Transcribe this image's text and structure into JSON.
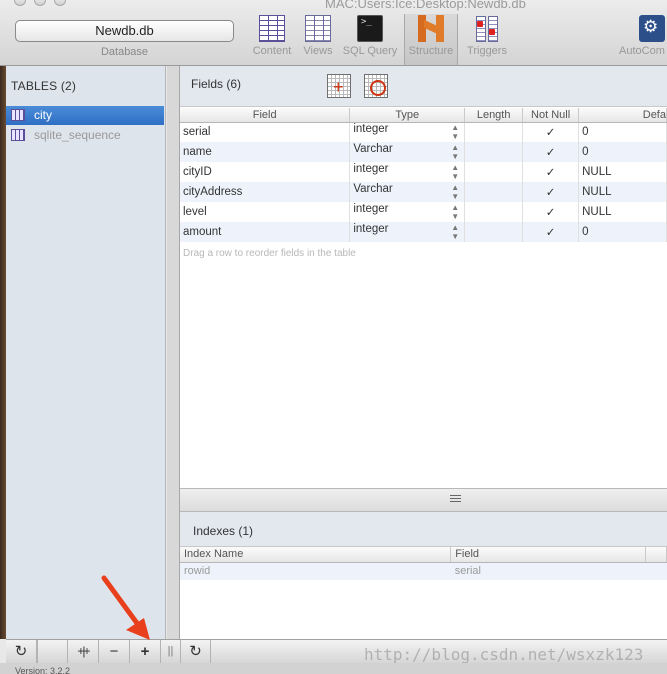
{
  "window": {
    "title": "MAC:Users:Ice:Desktop:Newdb.db"
  },
  "toolbar": {
    "database_value": "Newdb.db",
    "database_label": "Database",
    "items": [
      {
        "label": "Content",
        "icon": "table-icon"
      },
      {
        "label": "Views",
        "icon": "views-icon"
      },
      {
        "label": "SQL Query",
        "icon": "terminal-icon"
      },
      {
        "label": "Structure",
        "icon": "structure-icon"
      },
      {
        "label": "Triggers",
        "icon": "triggers-icon"
      },
      {
        "label": "AutoCom",
        "icon": "gear-icon"
      }
    ]
  },
  "sidebar": {
    "header": "TABLES (2)",
    "tables": [
      "city",
      "sqlite_sequence"
    ]
  },
  "fields": {
    "title": "Fields (6)",
    "columns": [
      "Field",
      "Type",
      "Length",
      "Not Null",
      "Defa"
    ],
    "rows": [
      {
        "field": "serial",
        "type": "integer",
        "length": "",
        "not_null": "✓",
        "default": "0"
      },
      {
        "field": "name",
        "type": "Varchar",
        "length": "",
        "not_null": "✓",
        "default": "0"
      },
      {
        "field": "cityID",
        "type": "integer",
        "length": "",
        "not_null": "✓",
        "default": "NULL"
      },
      {
        "field": "cityAddress",
        "type": "Varchar",
        "length": "",
        "not_null": "✓",
        "default": "NULL"
      },
      {
        "field": "level",
        "type": "integer",
        "length": "",
        "not_null": "✓",
        "default": "NULL"
      },
      {
        "field": "amount",
        "type": "integer",
        "length": "",
        "not_null": "✓",
        "default": "0"
      }
    ],
    "hint": "Drag a row to reorder fields in the table"
  },
  "indexes": {
    "title": "Indexes (1)",
    "columns": [
      "Index Name",
      "Field"
    ],
    "rows": [
      {
        "name": "rowid",
        "field": "serial"
      }
    ]
  },
  "bottombar": {
    "buttons": [
      {
        "glyph": "↻",
        "name": "refresh-tables-button"
      },
      {
        "glyph": "+|+",
        "name": "duplicate-table-button"
      },
      {
        "glyph": "−",
        "name": "remove-table-button"
      },
      {
        "glyph": "+",
        "name": "add-table-button"
      },
      {
        "glyph": "||",
        "name": "split-handle"
      },
      {
        "glyph": "↻",
        "name": "refresh-structure-button"
      }
    ]
  },
  "status": {
    "version": "Version: 3.2.2"
  },
  "watermark": "http://blog.csdn.net/wsxzk123",
  "colors": {
    "selection": "#2f6fc4",
    "annotation_arrow": "#e8401c"
  }
}
